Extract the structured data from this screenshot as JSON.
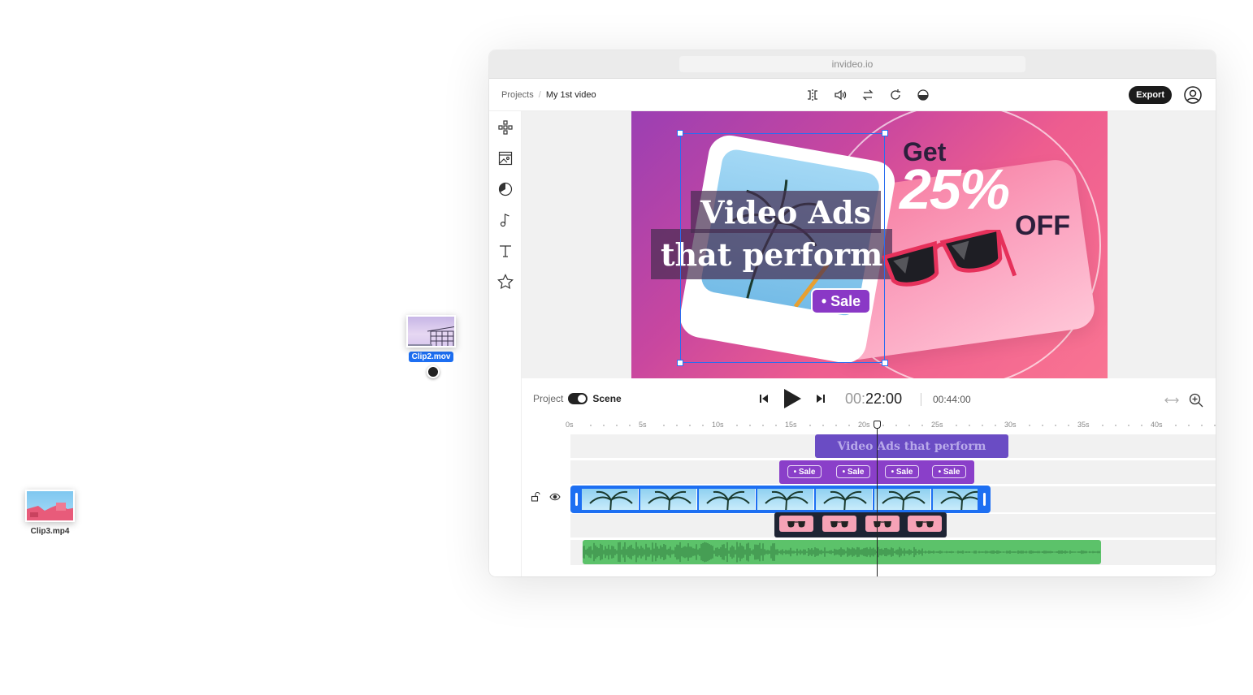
{
  "desktop": {
    "clip2": {
      "name": "Clip2.mov"
    },
    "clip3": {
      "name": "Clip3.mp4"
    }
  },
  "browser": {
    "url": "invideo.io"
  },
  "header": {
    "breadcrumb_root": "Projects",
    "breadcrumb_sep": "/",
    "breadcrumb_current": "My 1st video",
    "tools": [
      "flip-icon",
      "volume-icon",
      "swap-icon",
      "rotate-icon",
      "opacity-icon"
    ],
    "export_label": "Export"
  },
  "sidebar": {
    "tools": [
      "layout-icon",
      "media-icon",
      "sticker-icon",
      "music-icon",
      "text-icon",
      "star-icon"
    ]
  },
  "canvas": {
    "headline_line1": "Video Ads",
    "headline_line2": "that perform",
    "sale_badge": "• Sale",
    "offer_get": "Get",
    "offer_percent": "25%",
    "offer_off": "OFF"
  },
  "timeline": {
    "toggle_left": "Project",
    "toggle_right": "Scene",
    "current_time_dim": "00:",
    "current_time": "22:00",
    "total_time": "00:44:00",
    "ruler": [
      "0s",
      "5s",
      "10s",
      "15s",
      "20s",
      "25s",
      "30s",
      "35s",
      "40s"
    ],
    "text_clip": "Video Ads that perform",
    "sale_chips": [
      "• Sale",
      "• Sale",
      "• Sale",
      "• Sale"
    ]
  },
  "colors": {
    "accent": "#1d6ff2",
    "text_clip": "#6a4cc4",
    "sale_clip": "#8a3fc9",
    "audio_clip": "#5cc26a",
    "glasses_clip": "#1e2434"
  }
}
